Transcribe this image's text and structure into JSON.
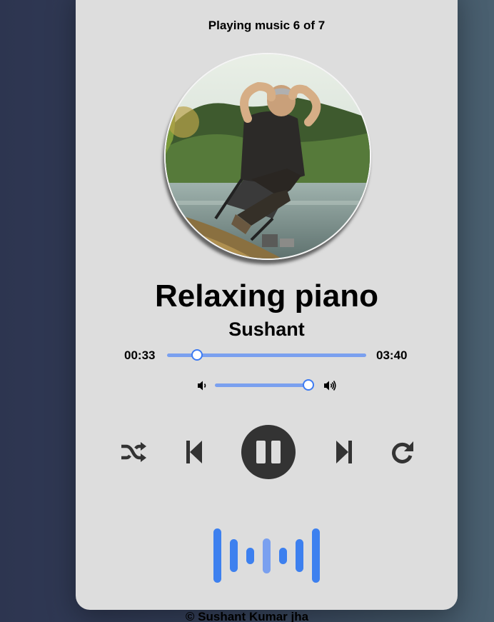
{
  "status": {
    "text": "Playing music 6 of 7"
  },
  "track": {
    "title": "Relaxing piano",
    "artist": "Sushant"
  },
  "progress": {
    "current": "00:33",
    "total": "03:40",
    "fraction": 0.15
  },
  "volume": {
    "fraction": 1.0
  },
  "controls": {
    "shuffle_icon": "shuffle-icon",
    "prev_icon": "skip-previous-icon",
    "play_state_icon": "pause-icon",
    "next_icon": "skip-next-icon",
    "repeat_icon": "repeat-icon"
  },
  "visualizer": {
    "levels": [
      1.0,
      0.6,
      0.3,
      0.65,
      0.3,
      0.6,
      1.0
    ]
  },
  "colors": {
    "accent": "#3d7bf2",
    "track": "#7aa0ef",
    "card": "#dddddd",
    "control": "#333333"
  },
  "footer": {
    "text": "© Sushant Kumar jha"
  }
}
